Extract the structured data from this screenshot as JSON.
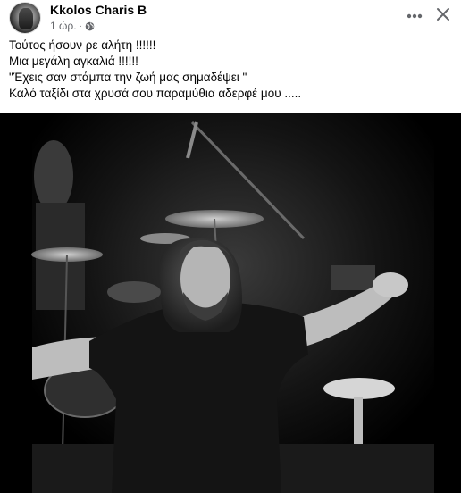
{
  "post": {
    "author_name": "Kkolos Charis B",
    "timestamp": "1 ώρ.",
    "separator": "·",
    "privacy_icon": "globe-icon",
    "more_icon": "more-horizontal-icon",
    "close_icon": "close-icon",
    "text_lines": [
      "Τούτος ήσουν ρε αλήτη !!!!!!",
      "Μια μεγάλη αγκαλιά !!!!!!",
      "\"Έχεις σαν στάμπα την ζωή μας σημαδέψει \"",
      "Καλό ταξίδι στα χρυσά σου παραμύθια  αδερφέ μου ....."
    ]
  },
  "colors": {
    "text_primary": "#050505",
    "text_secondary": "#65676b",
    "background": "#ffffff"
  }
}
